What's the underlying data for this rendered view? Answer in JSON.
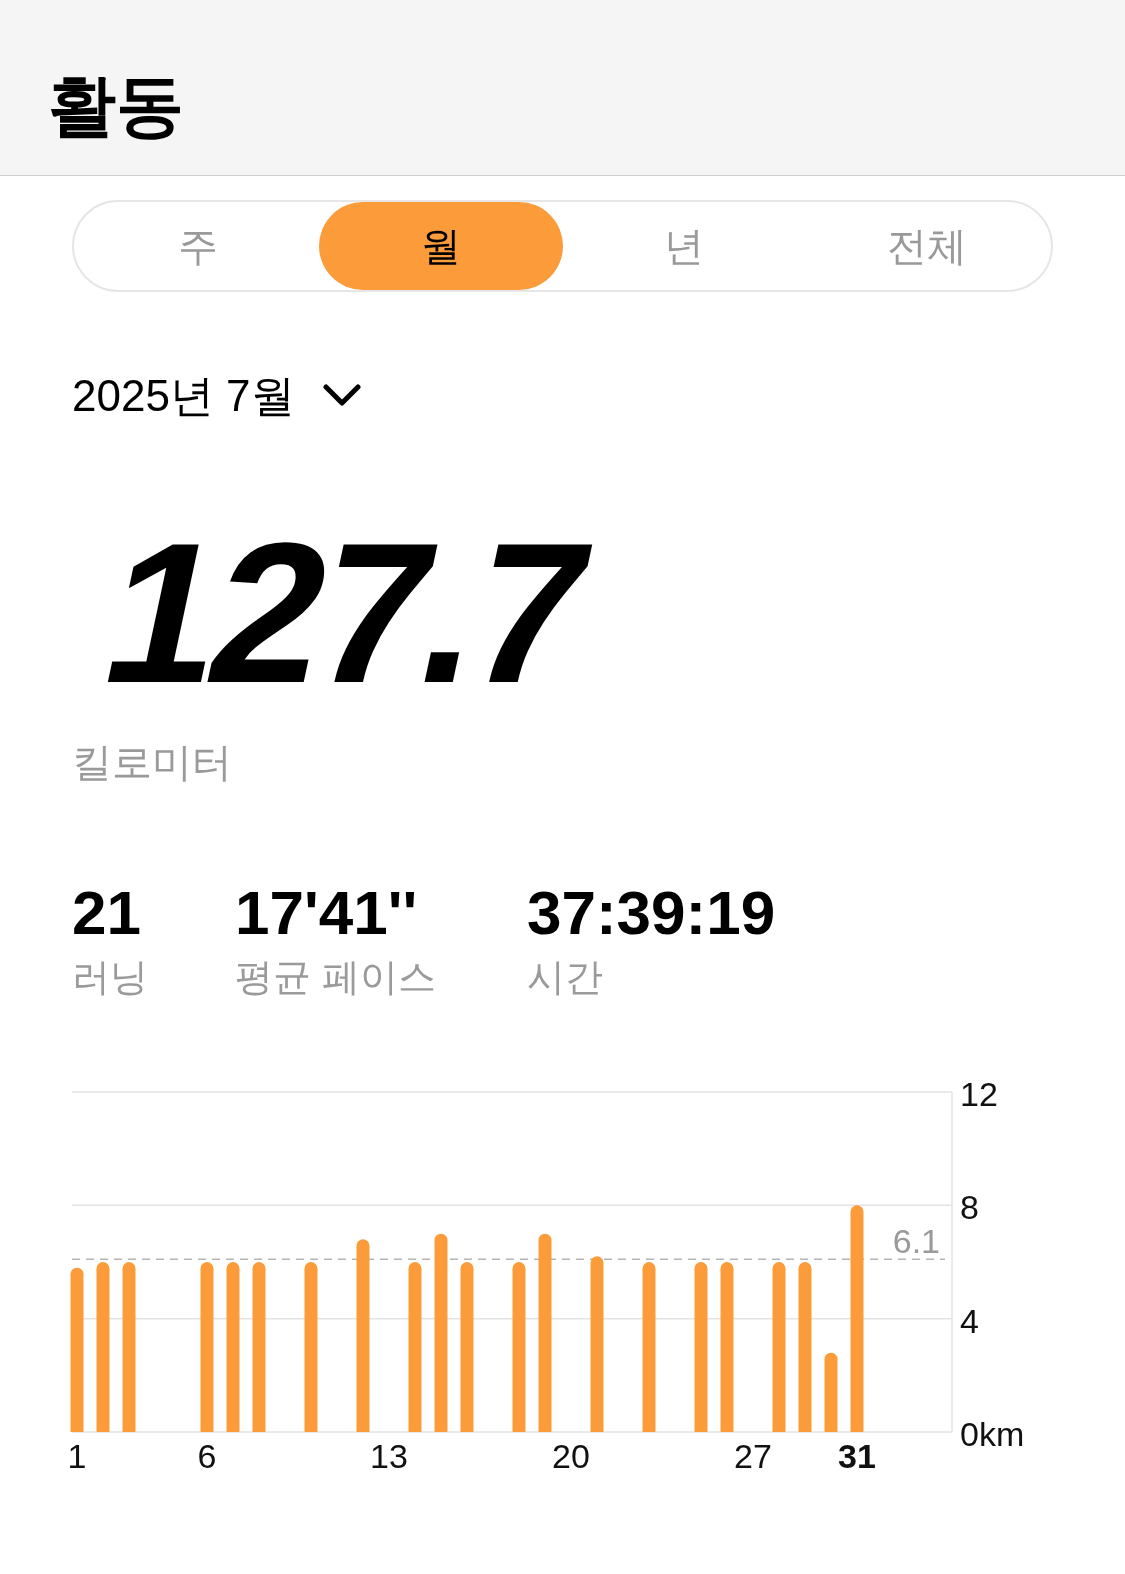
{
  "header": {
    "title": "활동"
  },
  "tabs": [
    {
      "label": "주",
      "selected": false
    },
    {
      "label": "월",
      "selected": true
    },
    {
      "label": "년",
      "selected": false
    },
    {
      "label": "전체",
      "selected": false
    }
  ],
  "period": {
    "label": "2025년 7월"
  },
  "total": {
    "value": "127.7",
    "unit": "킬로미터"
  },
  "stats": [
    {
      "value": "21",
      "label": "러닝"
    },
    {
      "value": "17'41''",
      "label": "평균 페이스"
    },
    {
      "value": "37:39:19",
      "label": "시간"
    }
  ],
  "chart": {
    "chart_data": {
      "type": "bar",
      "x": [
        1,
        2,
        3,
        6,
        7,
        8,
        10,
        12,
        14,
        15,
        16,
        18,
        19,
        21,
        23,
        25,
        26,
        28,
        29,
        30,
        31
      ],
      "series": [
        {
          "color": "#fb9b3a",
          "values": [
            5.8,
            6.0,
            6.0,
            6.0,
            6.0,
            6.0,
            6.0,
            6.8,
            6.0,
            7.0,
            6.0,
            6.0,
            7.0,
            6.2,
            6.0,
            6.0,
            6.0,
            6.0,
            6.0,
            2.8,
            8.0
          ]
        }
      ],
      "xlim": [
        1,
        31
      ],
      "ylim": [
        0,
        12
      ],
      "yticks": [
        {
          "value": 0,
          "label": "0km"
        },
        4,
        8,
        12
      ],
      "xticks": [
        1,
        6,
        13,
        20,
        27,
        31
      ],
      "ref_lines": [
        {
          "axis": "y",
          "value": 6.1,
          "label": "6.1"
        }
      ]
    }
  }
}
